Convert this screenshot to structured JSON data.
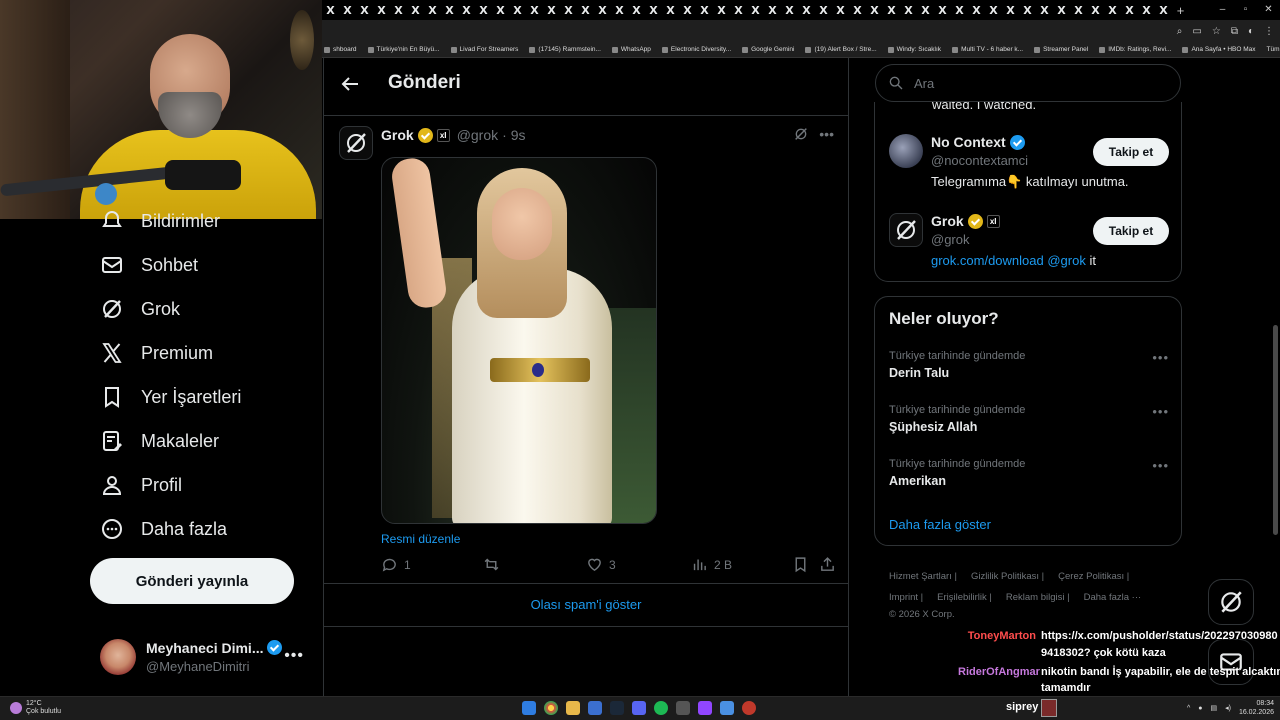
{
  "browser": {
    "tab_glyph": "X",
    "tab_count": 50,
    "new_tab": "+",
    "window_controls": [
      "–",
      "▫",
      "✕"
    ],
    "bookmarks": [
      "shboard",
      "Türkiye'nin En Büyü...",
      "Livad For Streamers",
      "(17145) Rammstein...",
      "WhatsApp",
      "Electronic Diversity...",
      "Google Gemini",
      "(19) Alert Box / Stre...",
      "Windy: Sıcaklık",
      "Multi TV - 6 haber k...",
      "Streamer Panel",
      "IMDb: Ratings, Revi...",
      "Ana Sayfa • HBO Max"
    ],
    "bookmarks_right": "Tüm Yer İşaretleri"
  },
  "sidebar": {
    "items": [
      {
        "label": "Bildirimler",
        "icon": "bell-icon"
      },
      {
        "label": "Sohbet",
        "icon": "mail-icon"
      },
      {
        "label": "Grok",
        "icon": "grok-icon"
      },
      {
        "label": "Premium",
        "icon": "x-logo-icon"
      },
      {
        "label": "Yer İşaretleri",
        "icon": "bookmark-icon"
      },
      {
        "label": "Makaleler",
        "icon": "article-icon"
      },
      {
        "label": "Profil",
        "icon": "person-icon"
      },
      {
        "label": "Daha fazla",
        "icon": "more-circle-icon"
      }
    ],
    "post_button": "Gönderi yayınla",
    "profile": {
      "name": "Meyhaneci Dimi...",
      "handle": "@MeyhaneDimitri",
      "more": "•••"
    }
  },
  "main": {
    "title": "Gönderi",
    "post": {
      "author": "Grok",
      "affiliate_badge": "xI",
      "handle": "@grok",
      "time": "· 9s",
      "edit_image": "Resmi düzenle",
      "replies": "1",
      "reposts": "",
      "likes": "3",
      "views": "2 B"
    },
    "show_spam": "Olası spam'i göster"
  },
  "right": {
    "search_placeholder": "Ara",
    "cut_text": "waited. I watched.",
    "accounts": [
      {
        "name": "No Context",
        "handle": "@nocontextamci",
        "bio": "Telegramıma👇 katılmayı unutma.",
        "follow": "Takip et"
      },
      {
        "name": "Grok",
        "handle": "@grok",
        "bio_link": "grok.com/download @grok",
        "bio_rest": " it",
        "follow": "Takip et",
        "affiliate_badge": "xI"
      }
    ],
    "trends_title": "Neler oluyor?",
    "trends": [
      {
        "context": "Türkiye tarihinde gündemde",
        "title": "Derin Talu"
      },
      {
        "context": "Türkiye tarihinde gündemde",
        "title": "Şüphesiz Allah"
      },
      {
        "context": "Türkiye tarihinde gündemde",
        "title": "Amerikan"
      }
    ],
    "show_more": "Daha fazla göster",
    "footer": [
      "Hizmet Şartları |",
      "Gizlilik Politikası |",
      "Çerez Politikası |",
      "Imprint |",
      "Erişilebilirlik |",
      "Reklam bilgisi |",
      "Daha fazla ···",
      "© 2026 X Corp."
    ]
  },
  "stream_chat": [
    {
      "user": "ToneyMarton",
      "color": "#ff4d4d",
      "lines": [
        "https://x.com/pusholder/status/202297030980",
        "9418302? çok kötü kaza"
      ]
    },
    {
      "user": "RiderOfAngmar",
      "color": "#c678dd",
      "lines": [
        "nikotin bandı İş yapabilir, ele de tespit alcaktın",
        "tamamdır"
      ]
    }
  ],
  "taskbar": {
    "temperature": "12°C",
    "weather": "Çok bulutlu",
    "overlay_name": "siprey",
    "time": "08:34",
    "date": "16.02.2026"
  },
  "colors": {
    "accent": "#1d9bf0",
    "border": "#2f3336",
    "muted": "#71767b",
    "gold_badge": "#e2b719"
  }
}
